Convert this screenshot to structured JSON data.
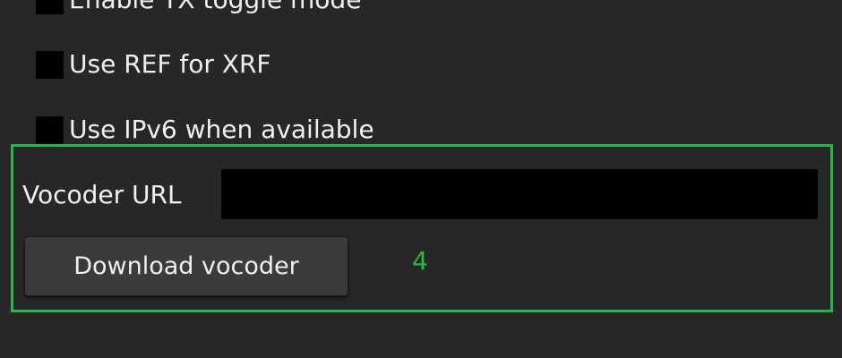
{
  "settings": {
    "checkboxes": [
      {
        "label": "Enable TX toggle mode",
        "checked": true
      },
      {
        "label": "Use REF for XRF",
        "checked": false
      },
      {
        "label": "Use IPv6 when available",
        "checked": false
      }
    ],
    "vocoder_url_label": "Vocoder URL",
    "vocoder_url_value": "",
    "download_button_label": "Download vocoder"
  },
  "annotation": {
    "number": "4",
    "color": "#2db54a"
  },
  "colors": {
    "background": "#272727",
    "field": "#000000",
    "button": "#3b3b3b",
    "text": "#f0f0f0"
  }
}
